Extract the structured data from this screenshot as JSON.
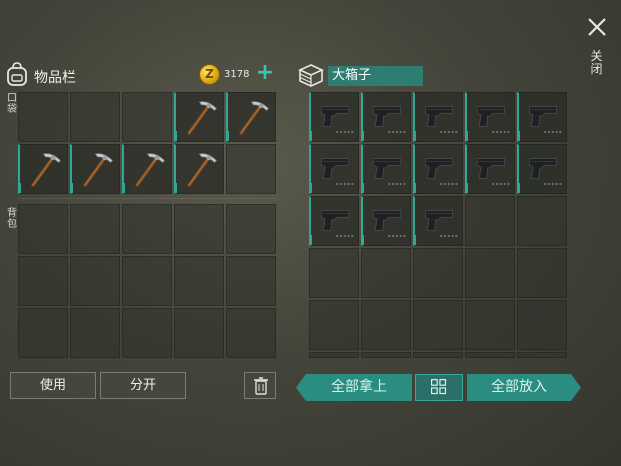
{
  "inventory": {
    "title": "物品栏",
    "currency": {
      "symbol": "Z",
      "amount": "3178"
    },
    "pocket_label": "口袋",
    "backpack_label": "背包",
    "pocket_slots": [
      "empty",
      "empty",
      "empty",
      "pickaxe",
      "pickaxe",
      "pickaxe",
      "pickaxe",
      "pickaxe",
      "pickaxe",
      "empty"
    ],
    "backpack_slots": [
      "empty",
      "empty",
      "empty",
      "empty",
      "empty",
      "empty",
      "empty",
      "empty",
      "empty",
      "empty",
      "empty",
      "empty",
      "empty",
      "empty",
      "empty"
    ],
    "use_label": "使用",
    "split_label": "分开"
  },
  "container": {
    "title": "大箱子",
    "slots": [
      "pistol",
      "pistol",
      "pistol",
      "pistol",
      "pistol",
      "pistol",
      "pistol",
      "pistol",
      "pistol",
      "pistol",
      "pistol",
      "pistol",
      "pistol",
      "empty",
      "empty",
      "empty",
      "empty",
      "empty",
      "empty",
      "empty",
      "empty",
      "empty",
      "empty",
      "empty",
      "empty",
      "empty",
      "empty",
      "empty",
      "empty",
      "empty"
    ],
    "take_all_label": "全部拿上",
    "put_all_label": "全部放入"
  },
  "close_label": "关闭",
  "colors": {
    "accent": "#2b8c80",
    "slot_edge": "#2fa89a",
    "coin": "#d9a512"
  }
}
